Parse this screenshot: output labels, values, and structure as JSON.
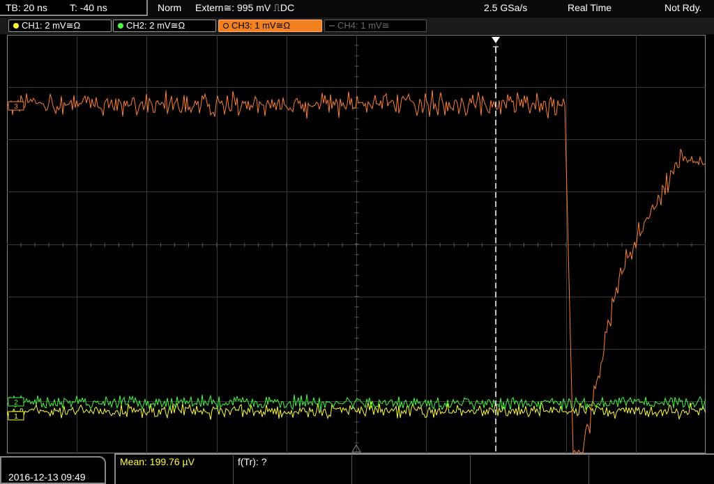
{
  "header": {
    "timebase": "TB: 20 ns",
    "trigger_offset": "T: -40 ns",
    "mode": "Norm",
    "trigger_source": "Extern≅: 995 mV ⎍DC",
    "sample_rate": "2.5 GSa/s",
    "acq_mode": "Real Time",
    "state": "Not Rdy."
  },
  "channels": [
    {
      "label": "CH1: 2 mV≅Ω",
      "color": "#ffff30",
      "state": "on"
    },
    {
      "label": "CH2: 2 mV≅Ω",
      "color": "#40ff40",
      "state": "on"
    },
    {
      "label": "CH3: 1 mV≅Ω",
      "color": "#ff8030",
      "state": "active"
    },
    {
      "label": "CH4: 1 mV≅",
      "color": "#606060",
      "state": "off"
    }
  ],
  "markers": {
    "trigger_marker": "T",
    "ch3_ref": "3",
    "ch2_ref": "2",
    "ch1_ref": "1"
  },
  "footer": {
    "datetime": "2016-12-13 09:49",
    "meas1": "Mean: 199.76 µV",
    "meas2": "f(Tr): ?"
  },
  "colors": {
    "ch1": "#ffff30",
    "ch2": "#40ff40",
    "ch3": "#ff8030",
    "grid": "#3a3a3a",
    "meas_text": "#ffff40"
  }
}
